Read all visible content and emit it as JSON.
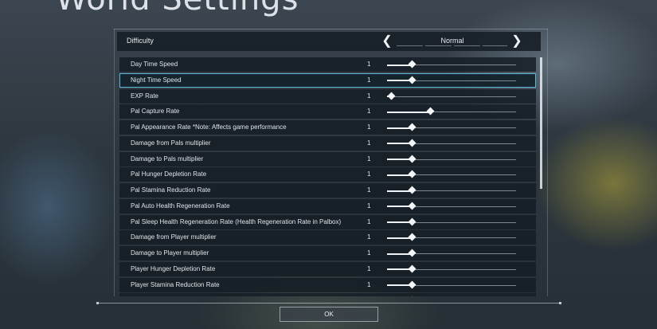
{
  "page_title": "World Settings",
  "difficulty": {
    "label": "Difficulty",
    "value": "Normal",
    "prev_icon": "chevron-left-icon",
    "next_icon": "chevron-right-icon"
  },
  "settings": [
    {
      "label": "Day Time Speed",
      "value": "1",
      "slider_fraction": 0.2
    },
    {
      "label": "Night Time Speed",
      "value": "1",
      "slider_fraction": 0.2
    },
    {
      "label": "EXP Rate",
      "value": "1",
      "slider_fraction": 0.04
    },
    {
      "label": "Pal Capture Rate",
      "value": "1",
      "slider_fraction": 0.34
    },
    {
      "label": "Pal Appearance Rate *Note: Affects game performance",
      "value": "1",
      "slider_fraction": 0.2
    },
    {
      "label": "Damage from Pals multiplier",
      "value": "1",
      "slider_fraction": 0.2
    },
    {
      "label": "Damage to Pals multiplier",
      "value": "1",
      "slider_fraction": 0.2
    },
    {
      "label": "Pal Hunger Depletion Rate",
      "value": "1",
      "slider_fraction": 0.2
    },
    {
      "label": "Pal Stamina Reduction Rate",
      "value": "1",
      "slider_fraction": 0.2
    },
    {
      "label": "Pal Auto Health Regeneration Rate",
      "value": "1",
      "slider_fraction": 0.2
    },
    {
      "label": "Pal Sleep Health Regeneration Rate (Health Regeneration Rate in Palbox)",
      "value": "1",
      "slider_fraction": 0.2
    },
    {
      "label": "Damage from Player multiplier",
      "value": "1",
      "slider_fraction": 0.2
    },
    {
      "label": "Damage to Player multiplier",
      "value": "1",
      "slider_fraction": 0.2
    },
    {
      "label": "Player Hunger Depletion Rate",
      "value": "1",
      "slider_fraction": 0.2
    },
    {
      "label": "Player Stamina Reduction Rate",
      "value": "1",
      "slider_fraction": 0.2
    },
    {
      "label": "",
      "value": "",
      "slider_fraction": 0.2
    }
  ],
  "selected_index": 1,
  "ok_button": {
    "label": "OK"
  },
  "colors": {
    "accent": "#5fb6d6",
    "panel": "#141c23"
  }
}
